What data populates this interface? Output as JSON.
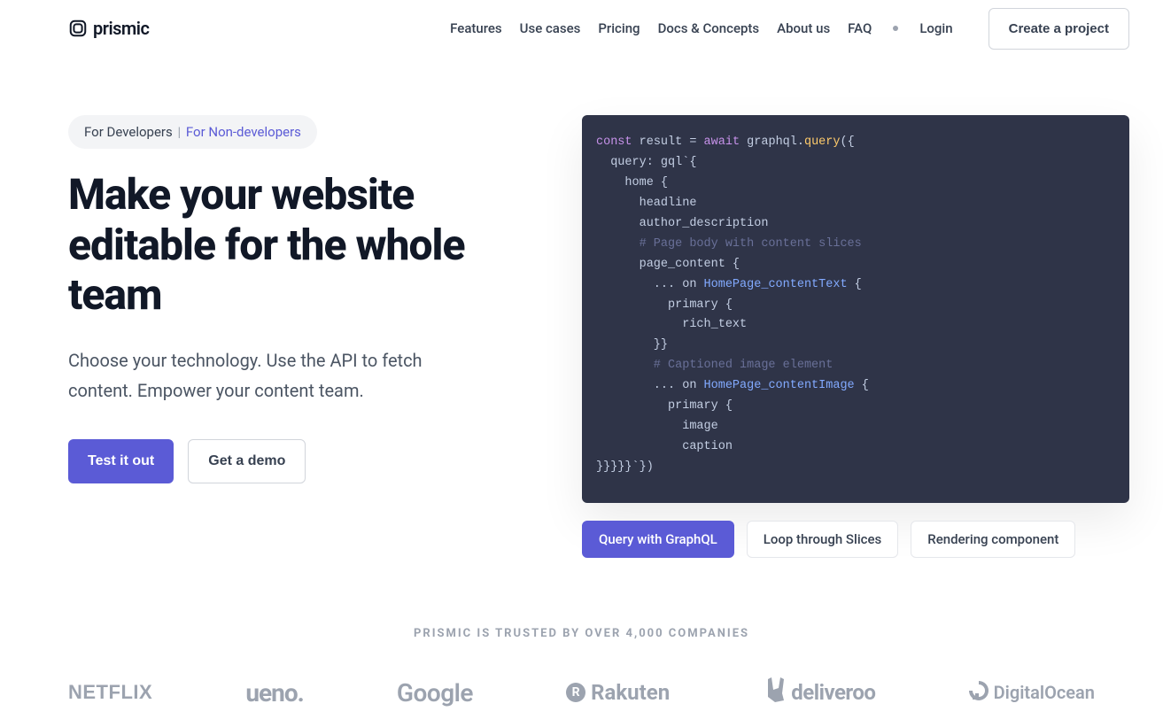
{
  "brand": "prismic",
  "nav": {
    "items": [
      "Features",
      "Use cases",
      "Pricing",
      "Docs & Concepts",
      "About us",
      "FAQ",
      "Login"
    ],
    "cta": "Create a project"
  },
  "hero": {
    "pill": {
      "part1": "For Developers",
      "sep": "|",
      "part2": "For Non-developers"
    },
    "headline": "Make your website editable for the whole team",
    "subhead": "Choose your technology. Use the API to fetch content. Empower your content team.",
    "primary_cta": "Test it out",
    "secondary_cta": "Get a demo"
  },
  "code": {
    "tokens": [
      {
        "t": "kw",
        "v": "const"
      },
      {
        "t": "plain",
        "v": " result "
      },
      {
        "t": "punct",
        "v": "="
      },
      {
        "t": "plain",
        "v": " "
      },
      {
        "t": "await",
        "v": "await"
      },
      {
        "t": "plain",
        "v": " graphql"
      },
      {
        "t": "punct",
        "v": "."
      },
      {
        "t": "fn",
        "v": "query"
      },
      {
        "t": "punct",
        "v": "({"
      },
      {
        "t": "nl"
      },
      {
        "t": "plain",
        "v": "  query: gql`{"
      },
      {
        "t": "nl"
      },
      {
        "t": "plain",
        "v": "    home {"
      },
      {
        "t": "nl"
      },
      {
        "t": "plain",
        "v": "      headline"
      },
      {
        "t": "nl"
      },
      {
        "t": "plain",
        "v": "      author_description"
      },
      {
        "t": "nl"
      },
      {
        "t": "comment",
        "v": "      # Page body with content slices"
      },
      {
        "t": "nl"
      },
      {
        "t": "plain",
        "v": "      page_content {"
      },
      {
        "t": "nl"
      },
      {
        "t": "plain",
        "v": "        ... on "
      },
      {
        "t": "type",
        "v": "HomePage_contentText"
      },
      {
        "t": "plain",
        "v": " {"
      },
      {
        "t": "nl"
      },
      {
        "t": "plain",
        "v": "          primary {"
      },
      {
        "t": "nl"
      },
      {
        "t": "plain",
        "v": "            rich_text"
      },
      {
        "t": "nl"
      },
      {
        "t": "plain",
        "v": "        }}"
      },
      {
        "t": "nl"
      },
      {
        "t": "comment",
        "v": "        # Captioned image element"
      },
      {
        "t": "nl"
      },
      {
        "t": "plain",
        "v": "        ... on "
      },
      {
        "t": "type",
        "v": "HomePage_contentImage"
      },
      {
        "t": "plain",
        "v": " {"
      },
      {
        "t": "nl"
      },
      {
        "t": "plain",
        "v": "          primary {"
      },
      {
        "t": "nl"
      },
      {
        "t": "plain",
        "v": "            image"
      },
      {
        "t": "nl"
      },
      {
        "t": "plain",
        "v": "            caption"
      },
      {
        "t": "nl"
      },
      {
        "t": "plain",
        "v": "}}}}}`})"
      }
    ]
  },
  "tabs": {
    "items": [
      {
        "label": "Query with GraphQL",
        "active": true
      },
      {
        "label": "Loop through Slices",
        "active": false
      },
      {
        "label": "Rendering component",
        "active": false
      }
    ]
  },
  "trust": {
    "label": "PRISMIC IS TRUSTED BY OVER 4,000 COMPANIES",
    "companies": [
      "NETFLIX",
      "ueno.",
      "Google",
      "Rakuten",
      "deliveroo",
      "DigitalOcean"
    ]
  }
}
